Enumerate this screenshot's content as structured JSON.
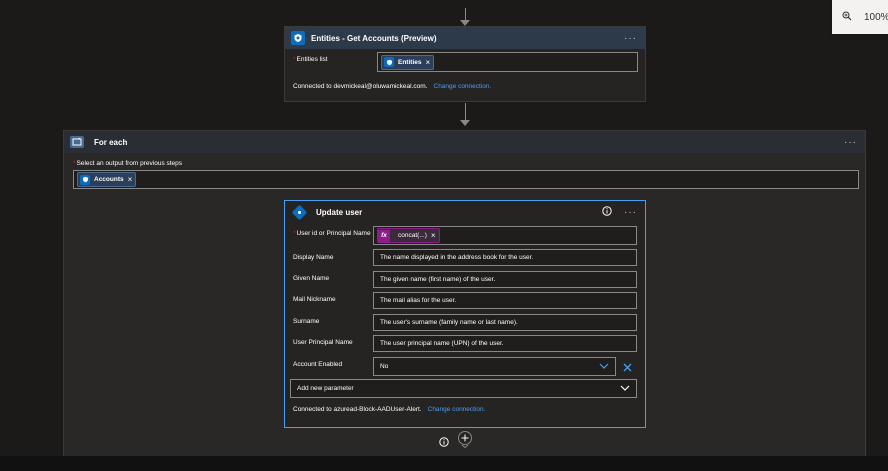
{
  "zoom": {
    "level": "100%"
  },
  "entities_card": {
    "title": "Entities - Get Accounts (Preview)",
    "more": "···",
    "field_label": "Entities list",
    "token": "Entities",
    "connection_text": "Connected to devmickeal@oluwamickeal.com.",
    "change_connection": "Change connection."
  },
  "foreach": {
    "title": "For each",
    "more": "···",
    "select_label": "Select an output from previous steps",
    "token": "Accounts"
  },
  "update_user": {
    "title": "Update user",
    "more": "···",
    "fields": [
      {
        "label": "User id or Principal Name",
        "required": true,
        "value": "concat(...)"
      },
      {
        "label": "Display Name",
        "value": "The name displayed in the address book for the user."
      },
      {
        "label": "Given Name",
        "value": "The given name (first name) of the user."
      },
      {
        "label": "Mail Nickname",
        "value": "The mail alias for the user."
      },
      {
        "label": "Surname",
        "value": "The user's surname (family name or last name)."
      },
      {
        "label": "User Principal Name",
        "value": "The user principal name (UPN) of the user."
      },
      {
        "label": "Account Enabled",
        "value": "No"
      }
    ],
    "add_param": "Add new parameter",
    "connection_text": "Connected to azuread-Block-AADUser-Alert.",
    "change_connection": "Change connection."
  },
  "colors": {
    "accent": "#479ef5",
    "header": "#2d3a4a",
    "fx": "#8a1f8a"
  }
}
